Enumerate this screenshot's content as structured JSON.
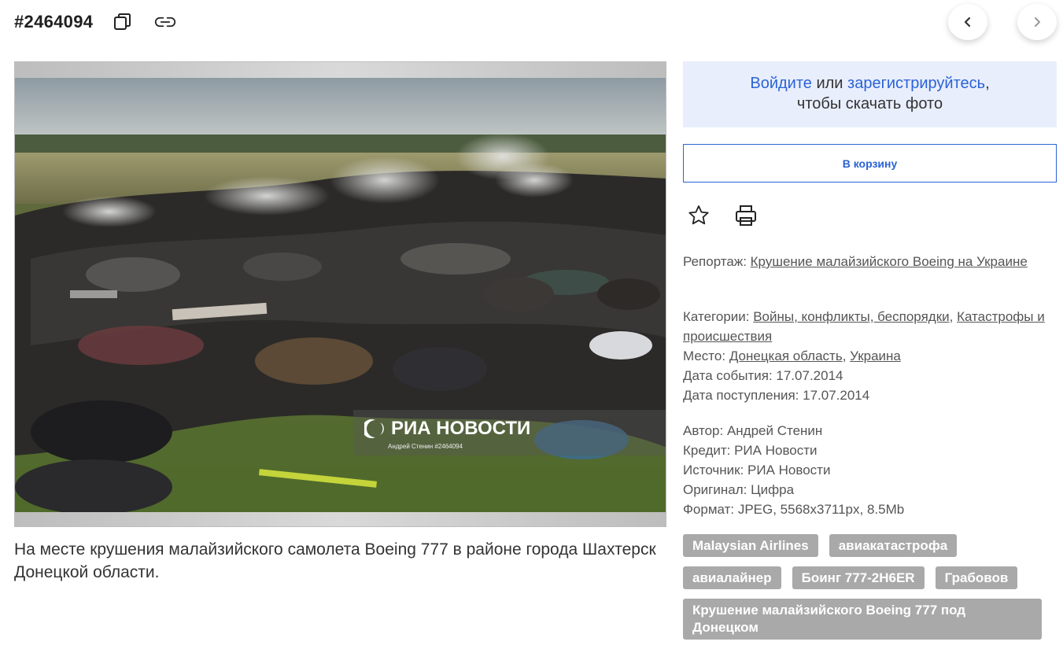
{
  "header": {
    "photo_id": "#2464094"
  },
  "photo": {
    "watermark_brand": "РИА НОВОСТИ",
    "watermark_credit": "Андрей Стенин #2464094",
    "caption": "На месте крушения малайзийского самолета Boeing 777 в районе города Шахтерск Донецкой области."
  },
  "sidebar": {
    "login_link": "Войдите",
    "login_or": " или ",
    "register_link": "зарегистрируйтесь",
    "login_comma": ",",
    "login_rest": "чтобы скачать фото",
    "cart_label": "В корзину",
    "report_label": "Репортаж: ",
    "report_value": "Крушение малайзийского Boeing на Украине",
    "categories_label": "Категории: ",
    "category_1": "Войны, конфликты, беспорядки",
    "comma": ", ",
    "category_2": "Катастрофы и происшествия",
    "place_label": "Место: ",
    "place_1": "Донецкая область",
    "place_2": "Украина",
    "event_date": "Дата события: 17.07.2014",
    "received_date": "Дата поступления: 17.07.2014",
    "author": "Автор: Андрей Стенин",
    "credit": "Кредит: РИА Новости",
    "source": "Источник: РИА Новости",
    "original": "Оригинал: Цифра",
    "format": "Формат: JPEG, 5568x3711px, 8.5Mb"
  },
  "tags": [
    "Malaysian Airlines",
    "авиакатастрофа",
    "авиалайнер",
    "Боинг 777-2H6ER",
    "Грабовов",
    "Крушение малайзийского Boeing 777 под Донецком"
  ],
  "icons": {
    "copy": "copy-icon",
    "link": "link-icon",
    "prev": "chevron-left-icon",
    "next": "chevron-right-icon",
    "favorite": "star-icon",
    "print": "printer-icon"
  },
  "colors": {
    "accent": "#2a63d6",
    "login_bg": "#e9eefc",
    "tag_bg": "#a9a9a9"
  }
}
